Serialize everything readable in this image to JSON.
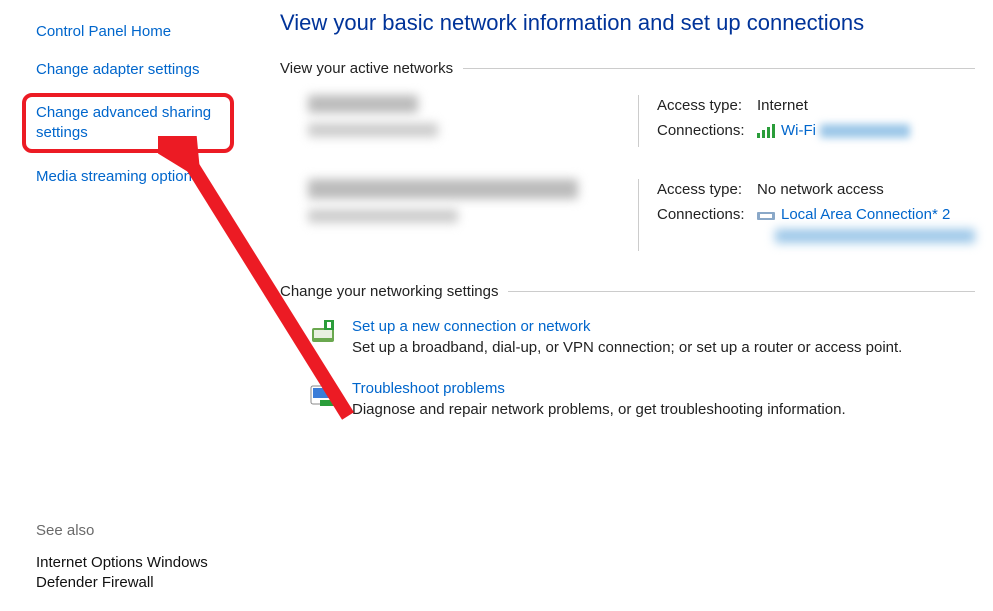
{
  "sidebar": {
    "home": "Control Panel Home",
    "adapter": "Change adapter settings",
    "advanced": "Change advanced sharing settings",
    "media": "Media streaming options",
    "seeAlso": "See also",
    "inetOpts": "Internet Options",
    "firewall": "Windows Defender Firewall"
  },
  "main": {
    "title": "View your basic network information and set up connections",
    "activeNetworks": "View your active networks",
    "accessType": "Access type:",
    "connections": "Connections:",
    "net1": {
      "access": "Internet",
      "conn": "Wi-Fi"
    },
    "net2": {
      "access": "No network access",
      "conn": "Local Area Connection* 2"
    },
    "changeSettings": "Change your networking settings",
    "setup": {
      "title": "Set up a new connection or network",
      "desc": "Set up a broadband, dial-up, or VPN connection; or set up a router or access point."
    },
    "trouble": {
      "title": "Troubleshoot problems",
      "desc": "Diagnose and repair network problems, or get troubleshooting information."
    }
  }
}
